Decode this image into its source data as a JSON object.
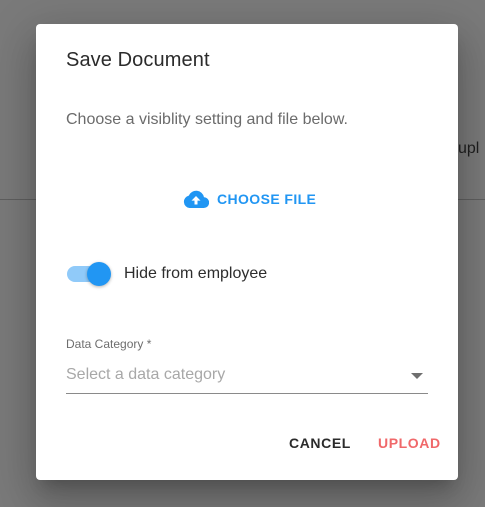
{
  "background": {
    "partial_text": "upl"
  },
  "dialog": {
    "title": "Save Document",
    "description": "Choose a visiblity setting and file below.",
    "choose_file": {
      "label": "CHOOSE FILE",
      "icon": "cloud-upload-icon"
    },
    "toggle": {
      "label": "Hide from employee",
      "checked": true
    },
    "data_category": {
      "label": "Data Category *",
      "placeholder": "Select a data category",
      "value": ""
    },
    "actions": {
      "cancel_label": "CANCEL",
      "upload_label": "UPLOAD"
    }
  },
  "colors": {
    "accent": "#2196f3",
    "accent_light": "#90caf9",
    "upload": "#f0686a",
    "overlay": "#7a7a7a"
  }
}
